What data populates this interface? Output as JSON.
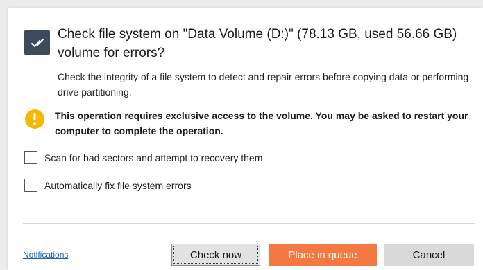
{
  "dialog": {
    "title": "Check file system on \"Data Volume (D:)\" (78.13 GB, used 56.66 GB) volume for errors?",
    "description": "Check the integrity of a file system to detect and repair errors before copying data or performing drive partitioning.",
    "warning": "This operation requires exclusive access to the volume. You may be asked to restart your computer to complete the operation.",
    "options": [
      {
        "label": "Scan for bad sectors and attempt to recovery them",
        "checked": false
      },
      {
        "label": "Automatically fix file system errors",
        "checked": false
      }
    ],
    "footer": {
      "notifications_link": "Notifications",
      "check_now_label": "Check now",
      "place_in_queue_label": "Place in queue",
      "cancel_label": "Cancel"
    },
    "icons": {
      "header": "disk-check-icon",
      "warning": "warning-icon"
    },
    "colors": {
      "accent": "#f47841",
      "header_icon_bg": "#3c4a5c",
      "warning": "#f5b800",
      "link": "#1a5fb4"
    }
  }
}
